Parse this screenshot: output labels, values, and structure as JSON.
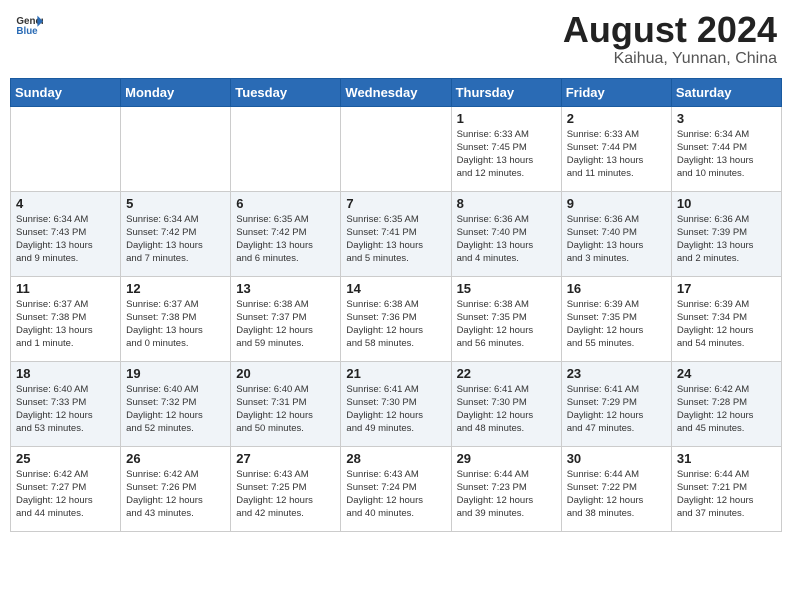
{
  "header": {
    "logo_general": "General",
    "logo_blue": "Blue",
    "month_year": "August 2024",
    "location": "Kaihua, Yunnan, China"
  },
  "days_of_week": [
    "Sunday",
    "Monday",
    "Tuesday",
    "Wednesday",
    "Thursday",
    "Friday",
    "Saturday"
  ],
  "weeks": [
    [
      {
        "day": "",
        "info": ""
      },
      {
        "day": "",
        "info": ""
      },
      {
        "day": "",
        "info": ""
      },
      {
        "day": "",
        "info": ""
      },
      {
        "day": "1",
        "info": "Sunrise: 6:33 AM\nSunset: 7:45 PM\nDaylight: 13 hours\nand 12 minutes."
      },
      {
        "day": "2",
        "info": "Sunrise: 6:33 AM\nSunset: 7:44 PM\nDaylight: 13 hours\nand 11 minutes."
      },
      {
        "day": "3",
        "info": "Sunrise: 6:34 AM\nSunset: 7:44 PM\nDaylight: 13 hours\nand 10 minutes."
      }
    ],
    [
      {
        "day": "4",
        "info": "Sunrise: 6:34 AM\nSunset: 7:43 PM\nDaylight: 13 hours\nand 9 minutes."
      },
      {
        "day": "5",
        "info": "Sunrise: 6:34 AM\nSunset: 7:42 PM\nDaylight: 13 hours\nand 7 minutes."
      },
      {
        "day": "6",
        "info": "Sunrise: 6:35 AM\nSunset: 7:42 PM\nDaylight: 13 hours\nand 6 minutes."
      },
      {
        "day": "7",
        "info": "Sunrise: 6:35 AM\nSunset: 7:41 PM\nDaylight: 13 hours\nand 5 minutes."
      },
      {
        "day": "8",
        "info": "Sunrise: 6:36 AM\nSunset: 7:40 PM\nDaylight: 13 hours\nand 4 minutes."
      },
      {
        "day": "9",
        "info": "Sunrise: 6:36 AM\nSunset: 7:40 PM\nDaylight: 13 hours\nand 3 minutes."
      },
      {
        "day": "10",
        "info": "Sunrise: 6:36 AM\nSunset: 7:39 PM\nDaylight: 13 hours\nand 2 minutes."
      }
    ],
    [
      {
        "day": "11",
        "info": "Sunrise: 6:37 AM\nSunset: 7:38 PM\nDaylight: 13 hours\nand 1 minute."
      },
      {
        "day": "12",
        "info": "Sunrise: 6:37 AM\nSunset: 7:38 PM\nDaylight: 13 hours\nand 0 minutes."
      },
      {
        "day": "13",
        "info": "Sunrise: 6:38 AM\nSunset: 7:37 PM\nDaylight: 12 hours\nand 59 minutes."
      },
      {
        "day": "14",
        "info": "Sunrise: 6:38 AM\nSunset: 7:36 PM\nDaylight: 12 hours\nand 58 minutes."
      },
      {
        "day": "15",
        "info": "Sunrise: 6:38 AM\nSunset: 7:35 PM\nDaylight: 12 hours\nand 56 minutes."
      },
      {
        "day": "16",
        "info": "Sunrise: 6:39 AM\nSunset: 7:35 PM\nDaylight: 12 hours\nand 55 minutes."
      },
      {
        "day": "17",
        "info": "Sunrise: 6:39 AM\nSunset: 7:34 PM\nDaylight: 12 hours\nand 54 minutes."
      }
    ],
    [
      {
        "day": "18",
        "info": "Sunrise: 6:40 AM\nSunset: 7:33 PM\nDaylight: 12 hours\nand 53 minutes."
      },
      {
        "day": "19",
        "info": "Sunrise: 6:40 AM\nSunset: 7:32 PM\nDaylight: 12 hours\nand 52 minutes."
      },
      {
        "day": "20",
        "info": "Sunrise: 6:40 AM\nSunset: 7:31 PM\nDaylight: 12 hours\nand 50 minutes."
      },
      {
        "day": "21",
        "info": "Sunrise: 6:41 AM\nSunset: 7:30 PM\nDaylight: 12 hours\nand 49 minutes."
      },
      {
        "day": "22",
        "info": "Sunrise: 6:41 AM\nSunset: 7:30 PM\nDaylight: 12 hours\nand 48 minutes."
      },
      {
        "day": "23",
        "info": "Sunrise: 6:41 AM\nSunset: 7:29 PM\nDaylight: 12 hours\nand 47 minutes."
      },
      {
        "day": "24",
        "info": "Sunrise: 6:42 AM\nSunset: 7:28 PM\nDaylight: 12 hours\nand 45 minutes."
      }
    ],
    [
      {
        "day": "25",
        "info": "Sunrise: 6:42 AM\nSunset: 7:27 PM\nDaylight: 12 hours\nand 44 minutes."
      },
      {
        "day": "26",
        "info": "Sunrise: 6:42 AM\nSunset: 7:26 PM\nDaylight: 12 hours\nand 43 minutes."
      },
      {
        "day": "27",
        "info": "Sunrise: 6:43 AM\nSunset: 7:25 PM\nDaylight: 12 hours\nand 42 minutes."
      },
      {
        "day": "28",
        "info": "Sunrise: 6:43 AM\nSunset: 7:24 PM\nDaylight: 12 hours\nand 40 minutes."
      },
      {
        "day": "29",
        "info": "Sunrise: 6:44 AM\nSunset: 7:23 PM\nDaylight: 12 hours\nand 39 minutes."
      },
      {
        "day": "30",
        "info": "Sunrise: 6:44 AM\nSunset: 7:22 PM\nDaylight: 12 hours\nand 38 minutes."
      },
      {
        "day": "31",
        "info": "Sunrise: 6:44 AM\nSunset: 7:21 PM\nDaylight: 12 hours\nand 37 minutes."
      }
    ]
  ]
}
